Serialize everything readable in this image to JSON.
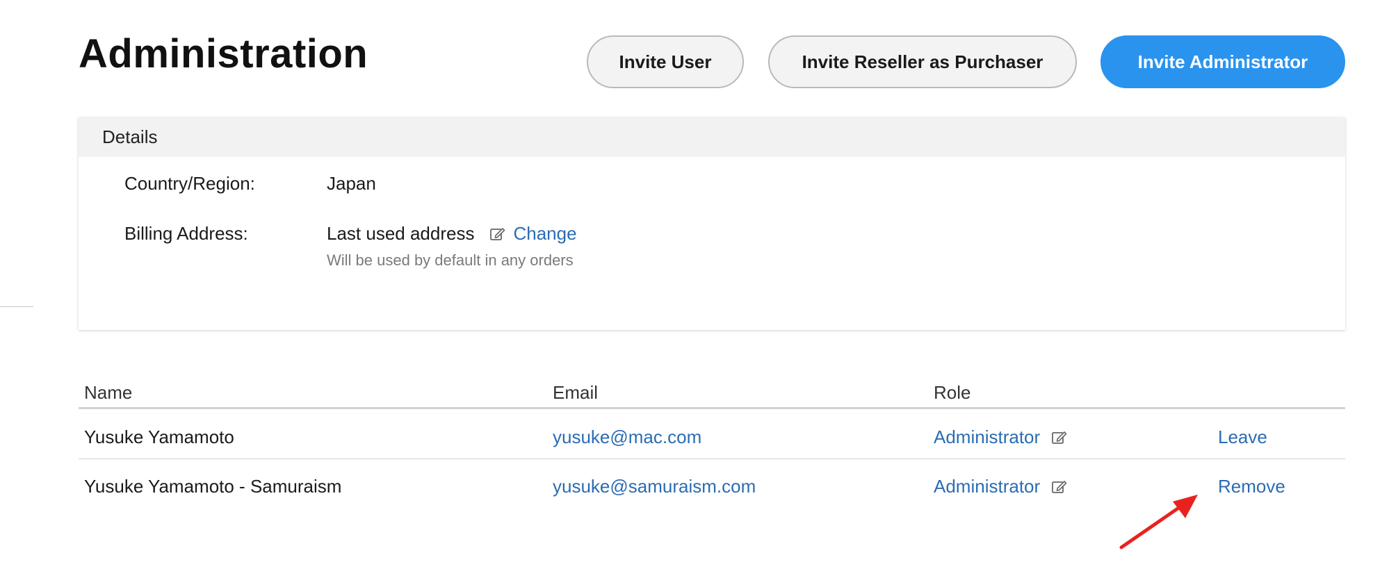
{
  "page": {
    "title": "Administration"
  },
  "toolbar": {
    "invite_user_label": "Invite User",
    "invite_reseller_label": "Invite Reseller as Purchaser",
    "invite_admin_label": "Invite Administrator"
  },
  "details": {
    "header": "Details",
    "country_label": "Country/Region:",
    "country_value": "Japan",
    "billing_label": "Billing Address:",
    "billing_value": "Last used address",
    "change_link": "Change",
    "billing_hint": "Will be used by default in any orders"
  },
  "table": {
    "columns": [
      "Name",
      "Email",
      "Role"
    ],
    "rows": [
      {
        "name": "Yusuke Yamamoto",
        "email": "yusuke@mac.com",
        "role": "Administrator",
        "action": "Leave"
      },
      {
        "name": "Yusuke Yamamoto - Samuraism",
        "email": "yusuke@samuraism.com",
        "role": "Administrator",
        "action": "Remove"
      }
    ]
  },
  "colors": {
    "primary": "#2a93ee",
    "link": "#2b6cb3",
    "annotation": "#e8231f"
  },
  "icons": {
    "edit": "edit-icon",
    "annotation": "red-arrow-icon"
  }
}
